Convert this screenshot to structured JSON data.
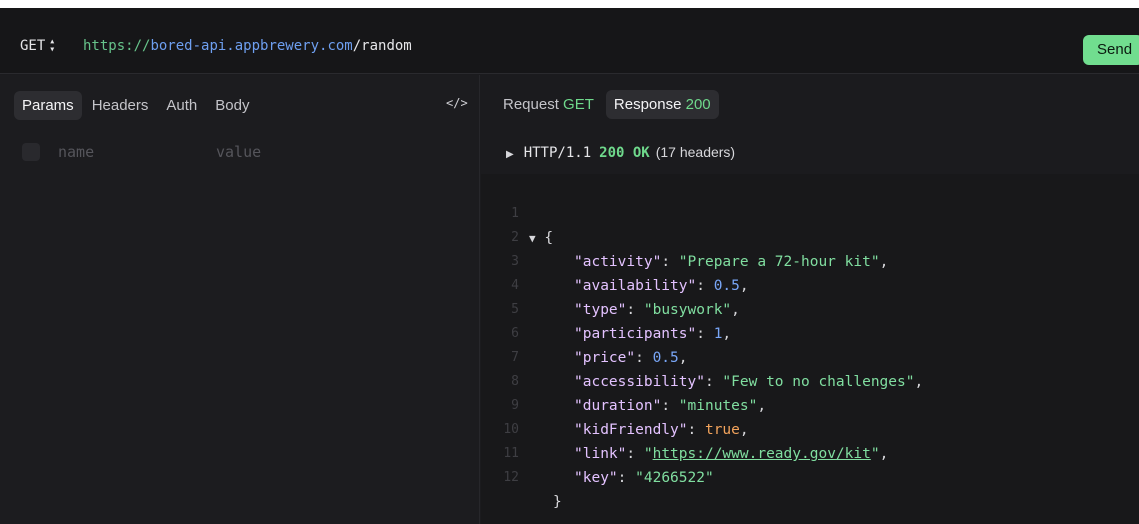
{
  "request": {
    "method": "GET",
    "url_scheme": "https://",
    "url_host": "bored-api.appbrewery.com",
    "url_path": "/random",
    "send_label": "Send"
  },
  "left_tabs": [
    "Params",
    "Headers",
    "Auth",
    "Body"
  ],
  "code_toggle": "</>",
  "params": {
    "name_placeholder": "name",
    "value_placeholder": "value"
  },
  "right_tabs": {
    "request_label": "Request",
    "request_method": "GET",
    "response_label": "Response",
    "response_code": "200"
  },
  "status": {
    "protocol": "HTTP/1.1",
    "code": "200 OK",
    "headers": "(17 headers)"
  },
  "body": {
    "line_numbers": [
      "1",
      "2",
      "3",
      "4",
      "5",
      "6",
      "7",
      "8",
      "9",
      "10",
      "11",
      "12"
    ],
    "open_brace": "{",
    "close_brace": "}",
    "fields": [
      {
        "key": "\"activity\"",
        "value": "\"Prepare a 72-hour kit\"",
        "kind": "s",
        "comma": ","
      },
      {
        "key": "\"availability\"",
        "value": "0.5",
        "kind": "n",
        "comma": ","
      },
      {
        "key": "\"type\"",
        "value": "\"busywork\"",
        "kind": "s",
        "comma": ","
      },
      {
        "key": "\"participants\"",
        "value": "1",
        "kind": "n",
        "comma": ","
      },
      {
        "key": "\"price\"",
        "value": "0.5",
        "kind": "n",
        "comma": ","
      },
      {
        "key": "\"accessibility\"",
        "value": "\"Few to no challenges\"",
        "kind": "s",
        "comma": ","
      },
      {
        "key": "\"duration\"",
        "value": "\"minutes\"",
        "kind": "s",
        "comma": ","
      },
      {
        "key": "\"kidFriendly\"",
        "value": "true",
        "kind": "b",
        "comma": ","
      },
      {
        "key": "\"link\"",
        "value_q1": "\"",
        "value_link": "https://www.ready.gov/kit",
        "value_q2": "\"",
        "kind": "u",
        "comma": ","
      },
      {
        "key": "\"key\"",
        "value": "\"4266522\"",
        "kind": "s",
        "comma": ""
      }
    ]
  },
  "colors": {
    "accent_green": "#71dd8f",
    "key_purple": "#e3c2ff",
    "string_green": "#80dea0",
    "number_blue": "#79a6f7",
    "bool_orange": "#f2a35c"
  }
}
